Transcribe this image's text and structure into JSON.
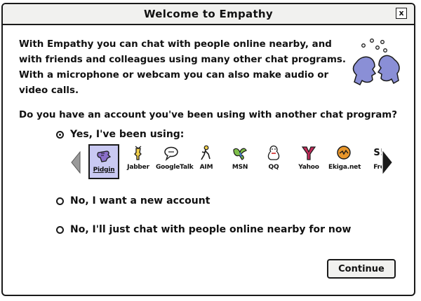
{
  "window": {
    "title": "Welcome to Empathy",
    "close_glyph": "x"
  },
  "intro": {
    "line1": "With Empathy you can chat with people online nearby, and",
    "line2": "with friends and colleagues using many other chat programs.",
    "line3": "With a microphone or webcam you can also make audio or video calls.",
    "illustration_icon": "talking-heads-icon",
    "illustration_color": "#8a8fd6"
  },
  "question": "Do you have an account you've been using with another chat program?",
  "options": [
    {
      "label": "Yes, I've been using:",
      "checked": true
    },
    {
      "label": "No, I want a new account",
      "checked": false
    },
    {
      "label": "No, I'll just chat with people online nearby for now",
      "checked": false
    }
  ],
  "protocols": {
    "items": [
      {
        "label": "Pidgin",
        "icon": "pidgin-icon",
        "selected": true
      },
      {
        "label": "Jabber",
        "icon": "jabber-icon",
        "selected": false
      },
      {
        "label": "GoogleTalk",
        "icon": "googletalk-icon",
        "selected": false
      },
      {
        "label": "AIM",
        "icon": "aim-icon",
        "selected": false
      },
      {
        "label": "MSN",
        "icon": "msn-icon",
        "selected": false
      },
      {
        "label": "QQ",
        "icon": "qq-icon",
        "selected": false
      },
      {
        "label": "Yahoo",
        "icon": "yahoo-icon",
        "selected": false
      },
      {
        "label": "Ekiga.net",
        "icon": "ekiga-icon",
        "selected": false
      },
      {
        "label": "Fre",
        "icon": "sip-icon",
        "selected": false
      }
    ],
    "last_icon_glyph": "S!",
    "selected_bg": "#c9c9f2"
  },
  "buttons": {
    "continue": "Continue"
  }
}
